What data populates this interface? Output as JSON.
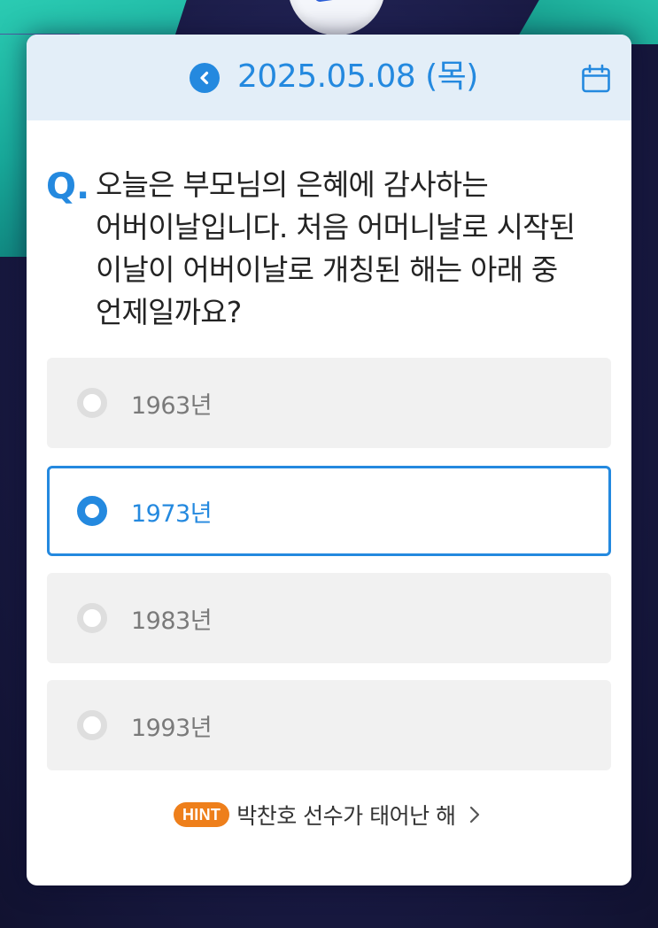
{
  "header": {
    "date": "2025.05.08 (목)",
    "back_icon": "chevron-left-icon",
    "calendar_icon": "calendar-icon",
    "accent_color": "#2489df",
    "background_color": "#e3eef8"
  },
  "question": {
    "marker": "Q.",
    "text": "오늘은 부모님의 은혜에 감사하는 어버이날입니다. 처음 어머니날로 시작된 이날이 어버이날로 개칭된 해는 아래 중 언제일까요?"
  },
  "options": [
    {
      "label": "1963년",
      "selected": false
    },
    {
      "label": "1973년",
      "selected": true
    },
    {
      "label": "1983년",
      "selected": false
    },
    {
      "label": "1993년",
      "selected": false
    }
  ],
  "hint": {
    "badge": "HINT",
    "text": "박찬호 선수가 태어난 해",
    "badge_color": "#ee7f1b",
    "chevron_icon": "chevron-right-icon"
  }
}
